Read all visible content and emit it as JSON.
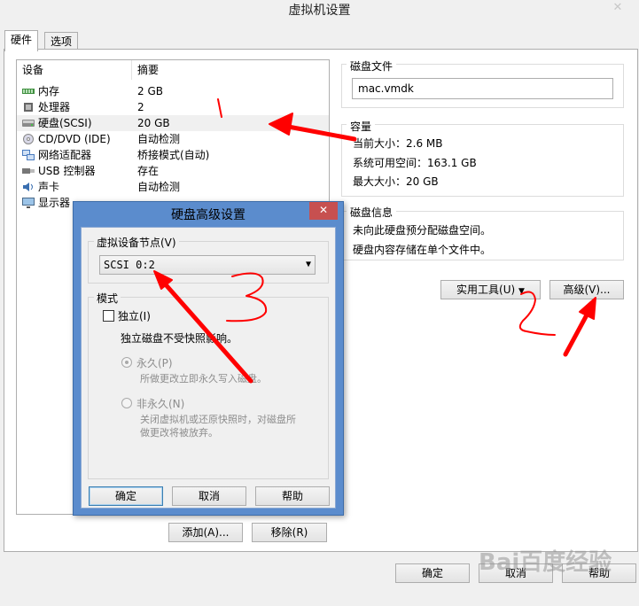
{
  "window": {
    "title": "虚拟机设置",
    "close_glyph": "✕"
  },
  "tabs": [
    {
      "label": "硬件"
    },
    {
      "label": "选项"
    }
  ],
  "device_list": {
    "columns": {
      "device": "设备",
      "summary": "摘要"
    },
    "rows": [
      {
        "name": "内存",
        "summary": "2 GB",
        "icon": "memory-icon"
      },
      {
        "name": "处理器",
        "summary": "2",
        "icon": "processor-icon"
      },
      {
        "name": "硬盘(SCSI)",
        "summary": "20 GB",
        "icon": "hard-disk-icon"
      },
      {
        "name": "CD/DVD (IDE)",
        "summary": "自动检测",
        "icon": "cd-dvd-icon"
      },
      {
        "name": "网络适配器",
        "summary": "桥接模式(自动)",
        "icon": "network-adapter-icon"
      },
      {
        "name": "USB 控制器",
        "summary": "存在",
        "icon": "usb-icon"
      },
      {
        "name": "声卡",
        "summary": "自动检测",
        "icon": "sound-card-icon"
      },
      {
        "name": "显示器",
        "summary": "",
        "icon": "display-icon"
      }
    ],
    "selected_row": "硬盘(SCSI)",
    "add_button": "添加(A)...",
    "remove_button": "移除(R)"
  },
  "disk_file": {
    "label": "磁盘文件",
    "value": "mac.vmdk"
  },
  "capacity": {
    "label": "容量",
    "current_size": "当前大小：2.6 MB",
    "available_space": "系统可用空间：163.1 GB",
    "max_size": "最大大小：20 GB"
  },
  "disk_info": {
    "label": "磁盘信息",
    "line1": "未向此硬盘预分配磁盘空间。",
    "line2": "硬盘内容存储在单个文件中。"
  },
  "utilities_button": "实用工具(U)",
  "advanced_button": "高级(V)...",
  "footer": {
    "ok": "确定",
    "cancel": "取消",
    "help": "帮助"
  },
  "dialog": {
    "title": "硬盘高级设置",
    "close_glyph": "✕",
    "vdn_label": "虚拟设备节点(V)",
    "vdn_value": "SCSI 0:2",
    "mode_label": "模式",
    "independent_label": "独立(I)",
    "independent_checked": false,
    "independent_desc": "独立磁盘不受快照影响。",
    "persistent_label": "永久(P)",
    "persistent_desc": "所做更改立即永久写入磁盘。",
    "nonpersistent_label": "非永久(N)",
    "nonpersistent_desc1": "关闭虚拟机或还原快照时，对磁盘所",
    "nonpersistent_desc2": "做更改将被放弃。",
    "ok": "确定",
    "cancel": "取消",
    "help": "帮助"
  },
  "annotations": {
    "color": "#ff0000",
    "numbers": [
      "1",
      "2",
      "3"
    ]
  },
  "watermark": "Bai百度经验"
}
